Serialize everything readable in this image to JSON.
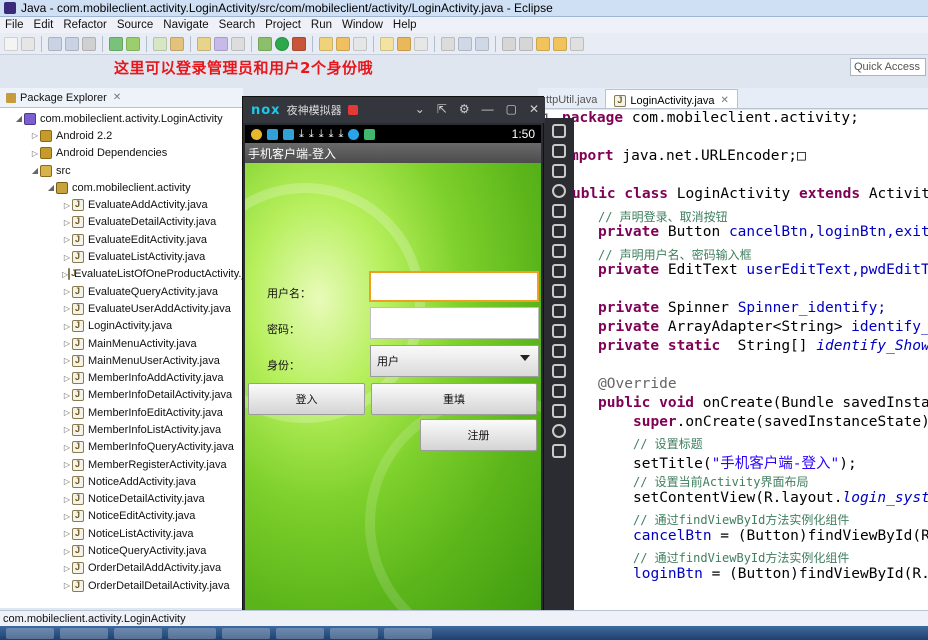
{
  "window": {
    "title": "Java - com.mobileclient.activity.LoginActivity/src/com/mobileclient/activity/LoginActivity.java - Eclipse"
  },
  "menu": [
    "File",
    "Edit",
    "Refactor",
    "Source",
    "Navigate",
    "Search",
    "Project",
    "Run",
    "Window",
    "Help"
  ],
  "banner": "这里可以登录管理员和用户2个身份哦",
  "quick_access": {
    "placeholder": "Quick Access"
  },
  "package_explorer": {
    "tab_label": "Package Explorer",
    "tab_close": "✕",
    "project": "com.mobileclient.activity.LoginActivity",
    "android_lib": "Android 2.2",
    "deps": "Android Dependencies",
    "src": "src",
    "package": "com.mobileclient.activity",
    "files": [
      "EvaluateAddActivity.java",
      "EvaluateDetailActivity.java",
      "EvaluateEditActivity.java",
      "EvaluateListActivity.java",
      "EvaluateListOfOneProductActivity.java",
      "EvaluateQueryActivity.java",
      "EvaluateUserAddActivity.java",
      "LoginActivity.java",
      "MainMenuActivity.java",
      "MainMenuUserActivity.java",
      "MemberInfoAddActivity.java",
      "MemberInfoDetailActivity.java",
      "MemberInfoEditActivity.java",
      "MemberInfoListActivity.java",
      "MemberInfoQueryActivity.java",
      "MemberRegisterActivity.java",
      "NoticeAddActivity.java",
      "NoticeDetailActivity.java",
      "NoticeEditActivity.java",
      "NoticeListActivity.java",
      "NoticeQueryActivity.java",
      "OrderDetailAddActivity.java",
      "OrderDetailDetailActivity.java"
    ]
  },
  "editor": {
    "tab_other": "ttpUtil.java",
    "tab_active": "LoginActivity.java",
    "tab_close": "✕",
    "line_number": "1",
    "lines": {
      "l1_kw": "package",
      "l1_rest": " com.mobileclient.activity;",
      "l2_kw": "mport",
      "l2_rest": " java.net.URLEncoder;□",
      "l3_kw1": "ublic class",
      "l3_mid": " LoginActivity ",
      "l3_kw2": "extends",
      "l3_rest": " Activit",
      "c1": "// 声明登录、取消按钮",
      "l5_kw": "private",
      "l5_type": " Button ",
      "l5_fld": "cancelBtn,loginBtn,exit",
      "c2": "// 声明用户名、密码输入框",
      "l7_kw": "private",
      "l7_type": " EditText ",
      "l7_fld": "userEditText,pwdEditT",
      "l8_kw": "private",
      "l8_type": " Spinner ",
      "l8_fld": "Spinner_identify;",
      "l9_kw": "private",
      "l9_type": " ArrayAdapter<String> ",
      "l9_fld": "identify_",
      "l10_kw": "private static",
      "l10_type": "  String[] ",
      "l10_fld": "identify_Show",
      "ann": "@Override",
      "l12_kw": "public void",
      "l12_rest": " onCreate(Bundle savedInsta",
      "l13_kw": "super",
      "l13_rest": ".onCreate(savedInstanceState)",
      "c3": "// 设置标题",
      "l15_a": "setTitle(",
      "l15_str": "\"手机客户端-登入\"",
      "l15_b": ");",
      "c4": "// 设置当前Activity界面布局",
      "l17_a": "setContentView(R.layout.",
      "l17_it": "login_syst",
      "c5": "// 通过findViewById方法实例化组件",
      "l19_fld": "cancelBtn",
      "l19_rest": " = (Button)findViewById(R",
      "c6": "// 通过findViewById方法实例化组件",
      "l21_fld": "loginBtn",
      "l21_rest": " = (Button)findViewById(R."
    }
  },
  "emulator": {
    "name": "夜神模拟器",
    "logo": "nox",
    "controls": [
      "⌄",
      "⇱",
      "⚙",
      "—",
      "▢",
      "✕"
    ],
    "clock": "1:50",
    "app_title": "手机客户端-登入",
    "form": {
      "username_label": "用户名：",
      "password_label": "密码：",
      "identity_label": "身份：",
      "identity_value": "用户",
      "login_button": "登入",
      "reset_button": "重填",
      "register_button": "注册"
    }
  },
  "statusbar": {
    "text": "com.mobileclient.activity.LoginActivity"
  },
  "colors": {
    "banner": "#e8161b",
    "nox_accent": "#1ec9e8",
    "focus_border": "#f0a020"
  }
}
